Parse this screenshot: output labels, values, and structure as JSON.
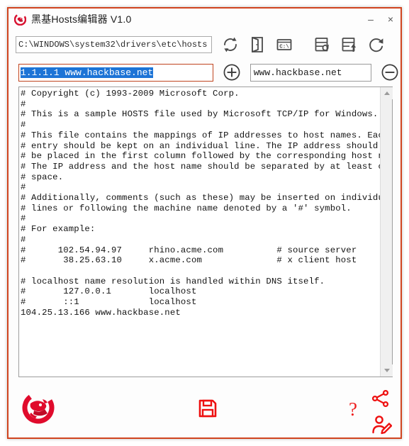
{
  "window": {
    "title": "黑基Hosts编辑器 V1.0",
    "border_color": "#d1441f",
    "accent_color": "#ee1c1c",
    "app_icon": "dragon-logo-icon",
    "controls": {
      "minimize_label": "–",
      "minimize_name": "minimize-icon",
      "close_label": "×",
      "close_name": "close-icon"
    }
  },
  "toolbar": {
    "path_field": {
      "value": "C:\\WINDOWS\\system32\\drivers\\etc\\hosts",
      "placeholder": "C:\\WINDOWS\\system32\\drivers\\etc\\hosts"
    },
    "buttons": [
      {
        "name": "refresh-icon",
        "label": "refresh"
      },
      {
        "name": "open-folder-icon",
        "label": "open folder"
      },
      {
        "name": "cmd-prompt-icon",
        "label": "C:\\"
      },
      {
        "name": "backup-hosts-icon",
        "label": "backup"
      },
      {
        "name": "restore-hosts-icon",
        "label": "restore"
      },
      {
        "name": "reset-icon",
        "label": "reset"
      }
    ],
    "cmd_icon_text": "C:\\"
  },
  "entry_row": {
    "entry_field": {
      "value": "1.1.1.1 www.hackbase.net",
      "selected": true,
      "placeholder": "1.1.1.1 www.hackbase.net",
      "selection_color": "#1d74d6",
      "border_color": "#c0441f"
    },
    "add_button": {
      "name": "add-entry-icon",
      "label": "+"
    },
    "host_field": {
      "value": "www.hackbase.net",
      "placeholder": "www.hackbase.net"
    },
    "remove_button": {
      "name": "remove-entry-icon",
      "label": "−"
    }
  },
  "editor": {
    "content": "# Copyright (c) 1993-2009 Microsoft Corp.\n#\n# This is a sample HOSTS file used by Microsoft TCP/IP for Windows.\n#\n# This file contains the mappings of IP addresses to host names. Each\n# entry should be kept on an individual line. The IP address should\n# be placed in the first column followed by the corresponding host name.\n# The IP address and the host name should be separated by at least one\n# space.\n#\n# Additionally, comments (such as these) may be inserted on individual\n# lines or following the machine name denoted by a '#' symbol.\n#\n# For example:\n#\n#      102.54.94.97     rhino.acme.com          # source server\n#       38.25.63.10     x.acme.com              # x client host\n\n# localhost name resolution is handled within DNS itself.\n#       127.0.0.1       localhost\n#       ::1             localhost\n104.25.13.166 www.hackbase.net",
    "scrollbar": {
      "up_arrow_name": "scroll-up-arrow-icon",
      "down_arrow_name": "scroll-down-arrow-icon"
    }
  },
  "bottom_bar": {
    "logo": {
      "name": "dragon-logo-icon"
    },
    "save": {
      "name": "save-floppy-icon"
    },
    "help": {
      "name": "help-question-icon",
      "label": "?"
    },
    "share": {
      "name": "share-icon"
    },
    "user_edit": {
      "name": "user-edit-icon"
    }
  }
}
